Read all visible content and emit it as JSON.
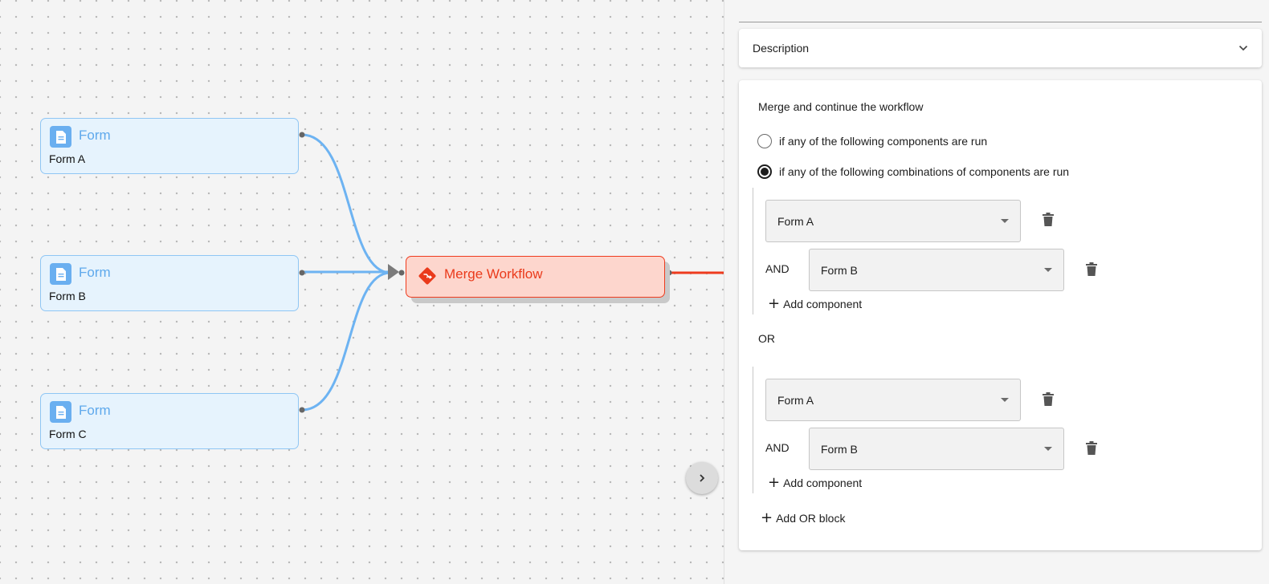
{
  "canvas": {
    "nodes": [
      {
        "type": "Form",
        "name": "Form A",
        "icon": "document-icon"
      },
      {
        "type": "Form",
        "name": "Form B",
        "icon": "document-icon"
      },
      {
        "type": "Form",
        "name": "Form C",
        "icon": "document-icon"
      }
    ],
    "merge_node": {
      "label": "Merge Workflow",
      "icon": "merge-icon"
    },
    "colors": {
      "form_edge": "#6db3f2",
      "merge_edge": "#ee3b1e",
      "merge_accent": "#ea3a1b",
      "form_accent": "#5fa9ec"
    },
    "collapse_button_icon": "chevron-right-icon"
  },
  "panel": {
    "description": {
      "label": "Description",
      "icon": "chevron-down-icon"
    },
    "heading": "Merge and continue the workflow",
    "options": [
      {
        "label": "if any of the following components are run",
        "selected": false
      },
      {
        "label": "if any of the following combinations of components are run",
        "selected": true
      }
    ],
    "blocks": [
      {
        "components": [
          "Form A",
          "Form B"
        ],
        "and_label": "AND",
        "add_component_label": "Add component"
      },
      {
        "components": [
          "Form A",
          "Form B"
        ],
        "and_label": "AND",
        "add_component_label": "Add component"
      }
    ],
    "or_label": "OR",
    "add_or_block_label": "Add OR block"
  }
}
